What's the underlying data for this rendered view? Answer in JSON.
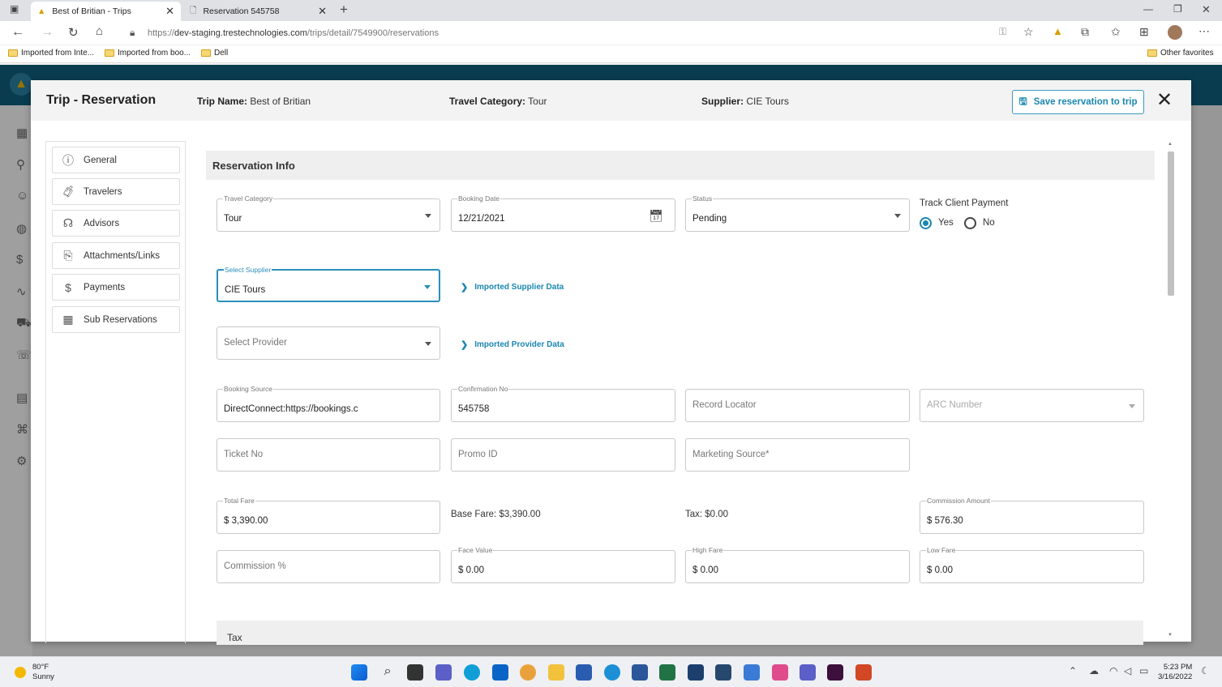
{
  "browser": {
    "tabs": [
      {
        "title": "Best of Britian - Trips",
        "active": true
      },
      {
        "title": "Reservation 545758",
        "active": false
      }
    ],
    "url_prefix": "https://",
    "url_host": "dev-staging.trestechnologies.com",
    "url_path": "/trips/detail/7549900/reservations",
    "bookmarks": [
      "Imported from Inte...",
      "Imported from boo...",
      "Dell"
    ],
    "other_favorites": "Other favorites"
  },
  "modal": {
    "title": "Trip - Reservation",
    "trip_name_label": "Trip Name:",
    "trip_name": "Best of Britian",
    "travel_category_label": "Travel Category:",
    "travel_category": "Tour",
    "supplier_label": "Supplier:",
    "supplier": "CIE Tours",
    "save_button": "Save reservation to trip"
  },
  "nav": {
    "items": [
      {
        "label": "General",
        "icon": "info-circle-icon"
      },
      {
        "label": "Travelers",
        "icon": "suitcase-icon"
      },
      {
        "label": "Advisors",
        "icon": "headset-icon"
      },
      {
        "label": "Attachments/Links",
        "icon": "paperclip-icon"
      },
      {
        "label": "Payments",
        "icon": "dollar-icon"
      },
      {
        "label": "Sub Reservations",
        "icon": "calendar-icon"
      }
    ]
  },
  "form": {
    "section_title": "Reservation Info",
    "travel_category": {
      "label": "Travel Category",
      "value": "Tour"
    },
    "booking_date": {
      "label": "Booking Date",
      "value": "12/21/2021"
    },
    "status": {
      "label": "Status",
      "value": "Pending"
    },
    "track_client_payment": {
      "label": "Track Client Payment",
      "yes": "Yes",
      "no": "No",
      "selected": "Yes"
    },
    "select_supplier": {
      "label": "Select Supplier",
      "value": "CIE Tours"
    },
    "imported_supplier_data": "Imported Supplier Data",
    "select_provider": {
      "placeholder": "Select Provider"
    },
    "imported_provider_data": "Imported Provider Data",
    "booking_source": {
      "label": "Booking Source",
      "value": "DirectConnect:https://bookings.c"
    },
    "confirmation_no": {
      "label": "Confirmation No",
      "value": "545758"
    },
    "record_locator": {
      "placeholder": "Record Locator"
    },
    "arc_number": {
      "placeholder": "ARC Number"
    },
    "ticket_no": {
      "placeholder": "Ticket No"
    },
    "promo_id": {
      "placeholder": "Promo ID"
    },
    "marketing_source": {
      "placeholder": "Marketing Source*"
    },
    "total_fare": {
      "label": "Total Fare",
      "value": "$ 3,390.00"
    },
    "base_fare": "Base Fare: $3,390.00",
    "tax": "Tax: $0.00",
    "commission_amount": {
      "label": "Commission Amount",
      "value": "$ 576.30"
    },
    "commission_pct": {
      "placeholder": "Commission %"
    },
    "face_value": {
      "label": "Face Value",
      "value": "$ 0.00"
    },
    "high_fare": {
      "label": "High Fare",
      "value": "$ 0.00"
    },
    "low_fare": {
      "label": "Low Fare",
      "value": "$ 0.00"
    },
    "tax_section": "Tax"
  },
  "taskbar": {
    "temperature": "80°F",
    "condition": "Sunny",
    "time": "5:23 PM",
    "date": "3/16/2022"
  },
  "colors": {
    "accent": "#1a87b0",
    "appbar": "#0f5d7a"
  }
}
